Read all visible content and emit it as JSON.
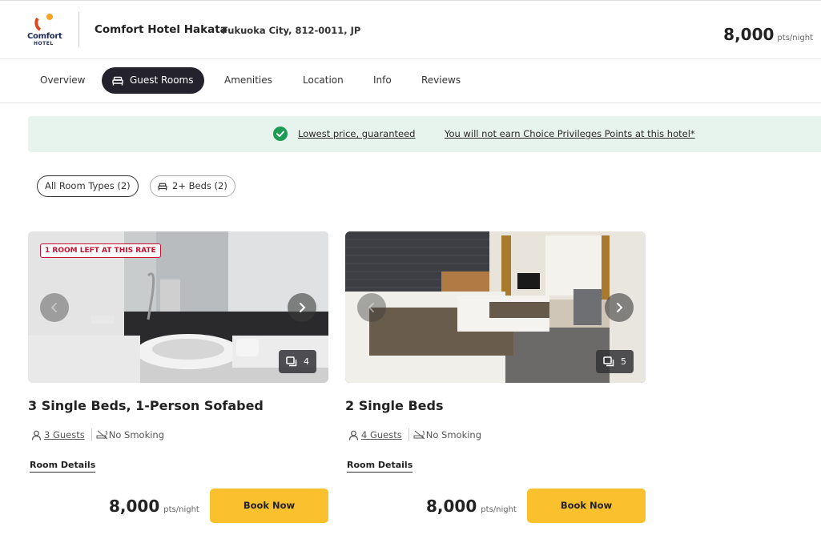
{
  "header": {
    "logo_text": "Comfort",
    "logo_subtext": "HOTEL",
    "hotel_name": "Comfort Hotel Hakata",
    "address": "Fukuoka City, 812-0011, JP",
    "price": "8,000",
    "price_unit": "pts/night"
  },
  "tabs": [
    {
      "label": "Overview"
    },
    {
      "label": "Guest Rooms"
    },
    {
      "label": "Amenities"
    },
    {
      "label": "Location"
    },
    {
      "label": "Info"
    },
    {
      "label": "Reviews"
    }
  ],
  "banner": {
    "link1": "Lowest price, guaranteed",
    "link2": "You will not earn Choice Privileges Points at this hotel*"
  },
  "filters": [
    {
      "label": "All Room Types (2)"
    },
    {
      "label": "2+ Beds (2)"
    }
  ],
  "rooms": [
    {
      "badge": "1 ROOM LEFT AT THIS RATE",
      "photo_count": "4",
      "title": "3 Single Beds, 1-Person Sofabed",
      "guests": "3 Guests",
      "smoking": "No Smoking",
      "details_label": "Room Details",
      "price": "8,000",
      "price_unit": "pts/night",
      "book_label": "Book Now"
    },
    {
      "badge": "",
      "photo_count": "5",
      "title": "2 Single Beds",
      "guests": "4 Guests",
      "smoking": "No Smoking",
      "details_label": "Room Details",
      "price": "8,000",
      "price_unit": "pts/night",
      "book_label": "Book Now"
    }
  ],
  "colors": {
    "brand_orange": "#f58220",
    "brand_navy": "#1d2a5c",
    "active_tab": "#24222d",
    "banner_bg": "#e7f3ed",
    "check_green": "#1d9b55",
    "book_button": "#fbc02d",
    "badge_red": "#c8102e"
  }
}
